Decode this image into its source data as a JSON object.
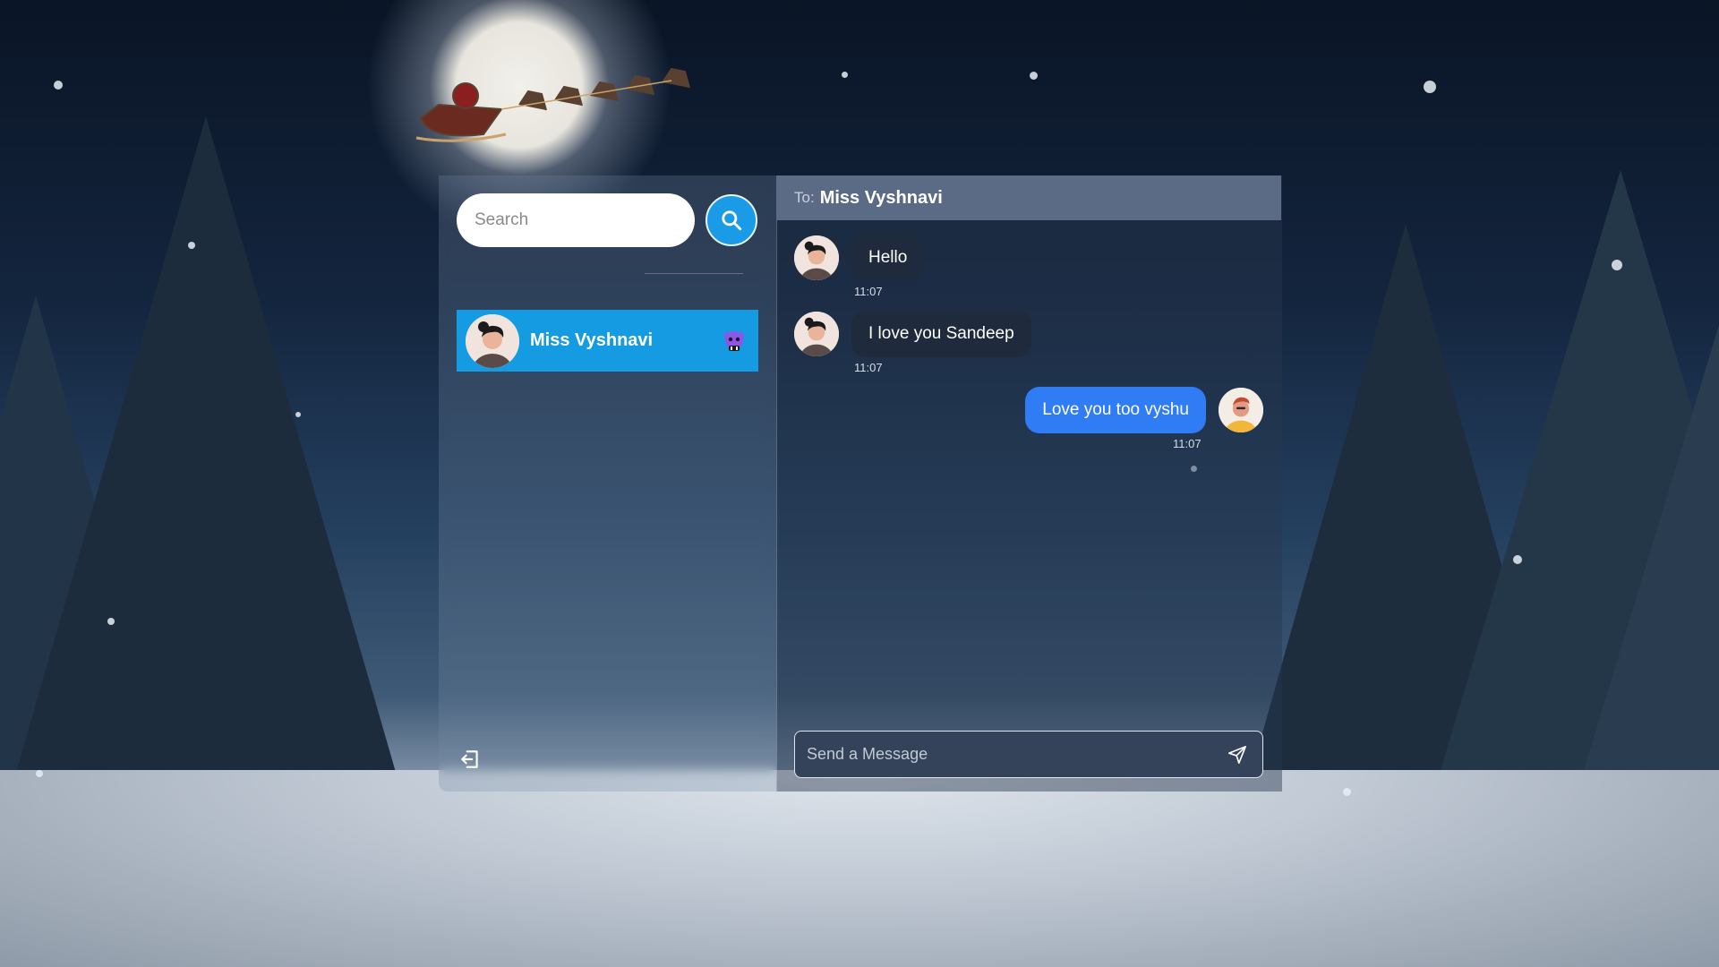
{
  "search": {
    "placeholder": "Search"
  },
  "contacts": [
    {
      "name": "Miss Vyshnavi"
    }
  ],
  "chat": {
    "to_label": "To:",
    "to_name": "Miss Vyshnavi",
    "messages": [
      {
        "direction": "incoming",
        "text": "Hello",
        "time": "11:07"
      },
      {
        "direction": "incoming",
        "text": "I love you Sandeep",
        "time": "11:07"
      },
      {
        "direction": "outgoing",
        "text": "Love you too vyshu",
        "time": "11:07"
      }
    ],
    "composer_placeholder": "Send a Message"
  },
  "icons": {
    "search": "search-icon",
    "group": "group-icon",
    "logout": "logout-icon",
    "send": "send-icon"
  },
  "colors": {
    "accent": "#159be2",
    "outgoing_bubble": "#2f7cf5",
    "incoming_bubble": "#1f2a3d",
    "header": "#5b6b86"
  }
}
